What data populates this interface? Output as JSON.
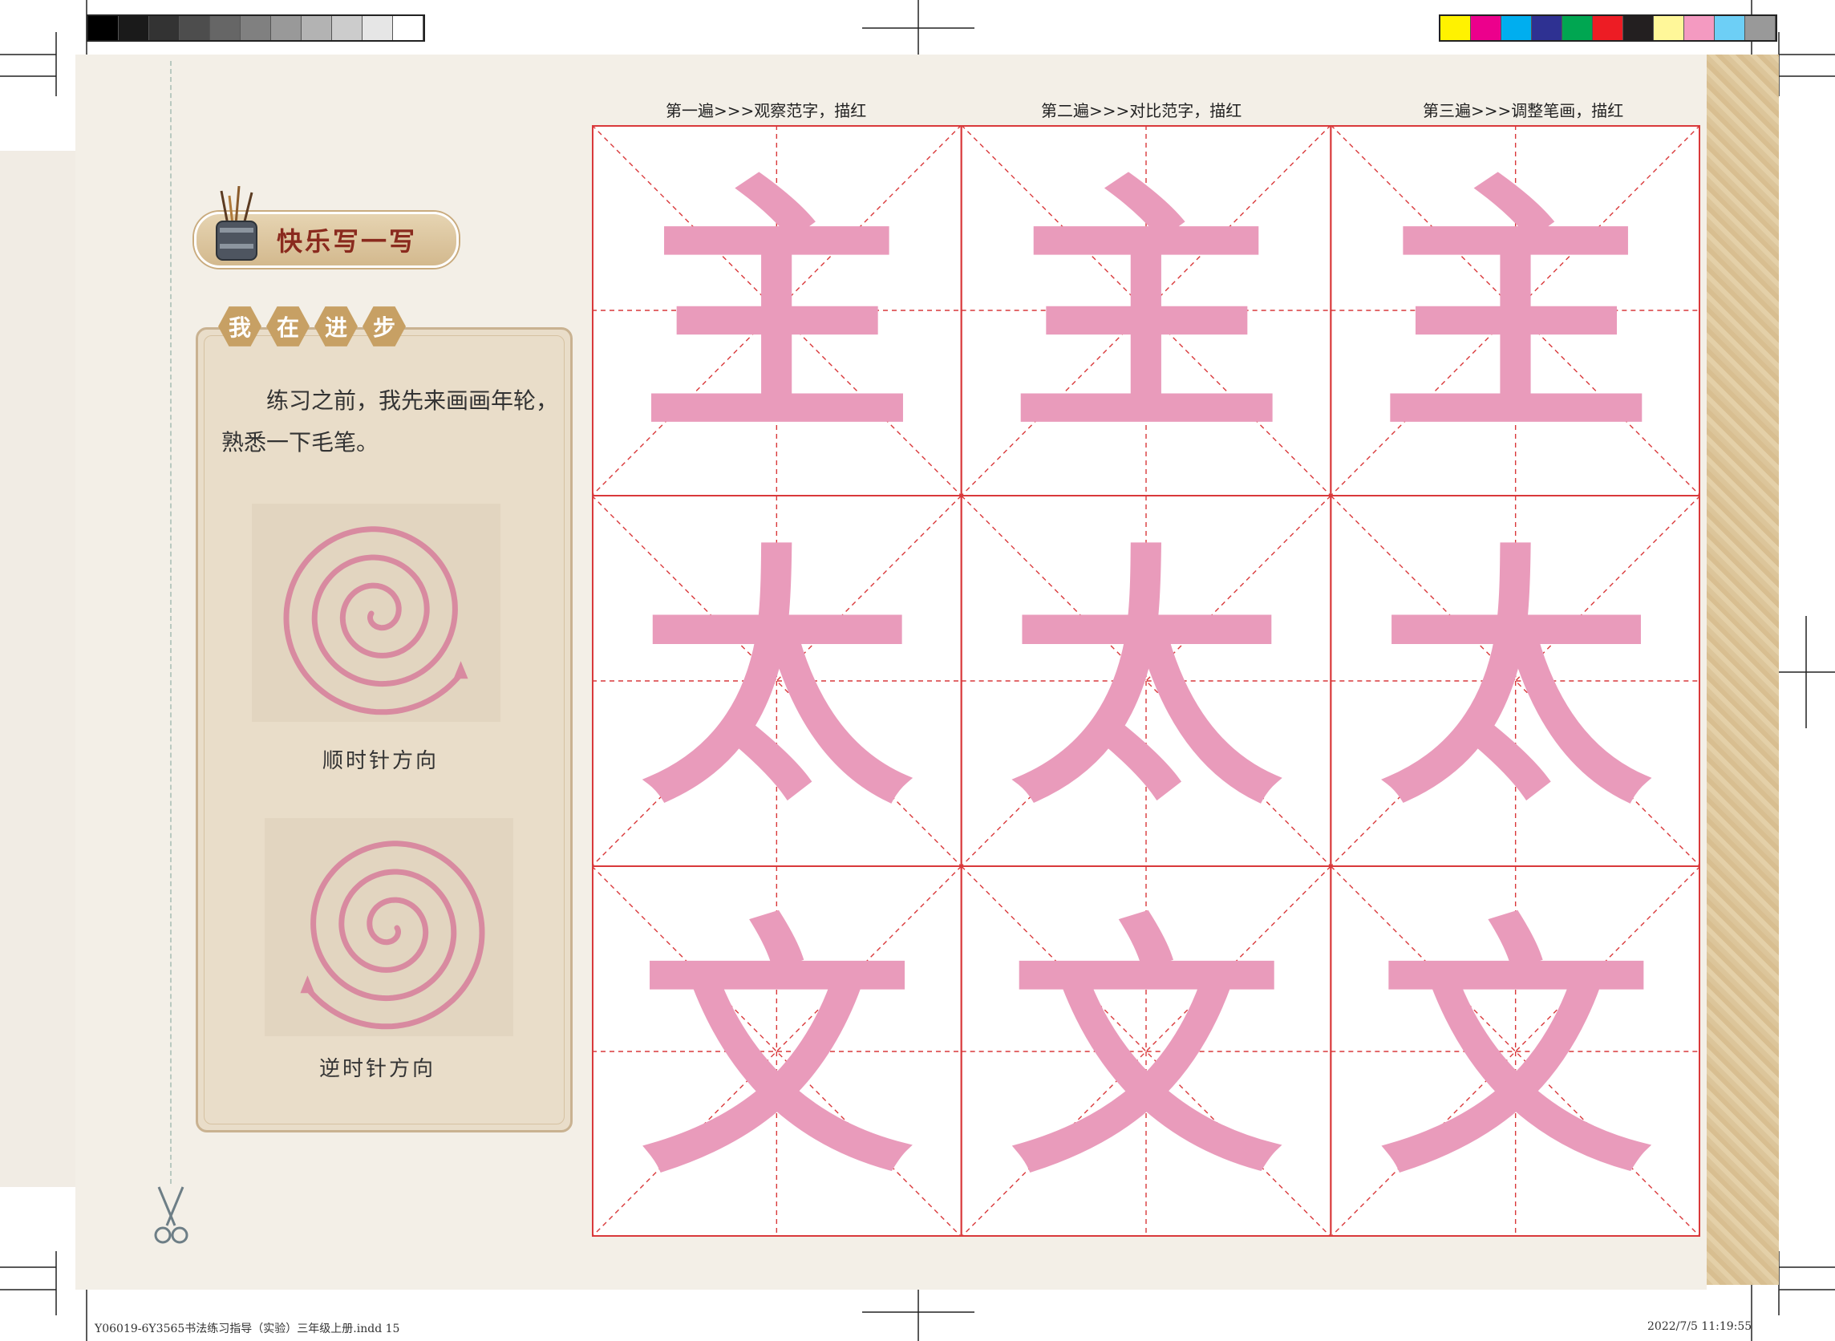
{
  "colors": {
    "grid_red": "#d9393b",
    "glyph_pink": "#e99bbb",
    "spiral_pink": "#d88aa0",
    "panel_bg": "#e9ddc9",
    "badge_text": "#8a2a1e"
  },
  "gray_bar": [
    "#000000",
    "#1a1a1a",
    "#333333",
    "#4d4d4d",
    "#666666",
    "#808080",
    "#999999",
    "#b3b3b3",
    "#cccccc",
    "#e6e6e6",
    "#ffffff"
  ],
  "color_bar": [
    "#fff200",
    "#ec008c",
    "#00aeef",
    "#2e3192",
    "#00a651",
    "#ed1c24",
    "#231f20",
    "#fff799",
    "#f49ac1",
    "#6dcff6",
    "#999999"
  ],
  "headers": {
    "pass1": "第一遍>>>观察范字，描红",
    "pass2": "第二遍>>>对比范字，描红",
    "pass3": "第三遍>>>调整笔画，描红"
  },
  "title": "快乐写一写",
  "progress": {
    "tags": [
      "我",
      "在",
      "进",
      "步"
    ],
    "intro": "练习之前，我先来画画年轮，熟悉一下毛笔。",
    "clockwise_caption": "顺时针方向",
    "counterclockwise_caption": "逆时针方向"
  },
  "grid": {
    "rows": [
      {
        "char": "主"
      },
      {
        "char": "太"
      },
      {
        "char": "文"
      }
    ]
  },
  "footer": {
    "file": "Y06019-6Y3565书法练习指导（实验）三年级上册.indd   15",
    "timestamp": "2022/7/5   11:19:55"
  }
}
